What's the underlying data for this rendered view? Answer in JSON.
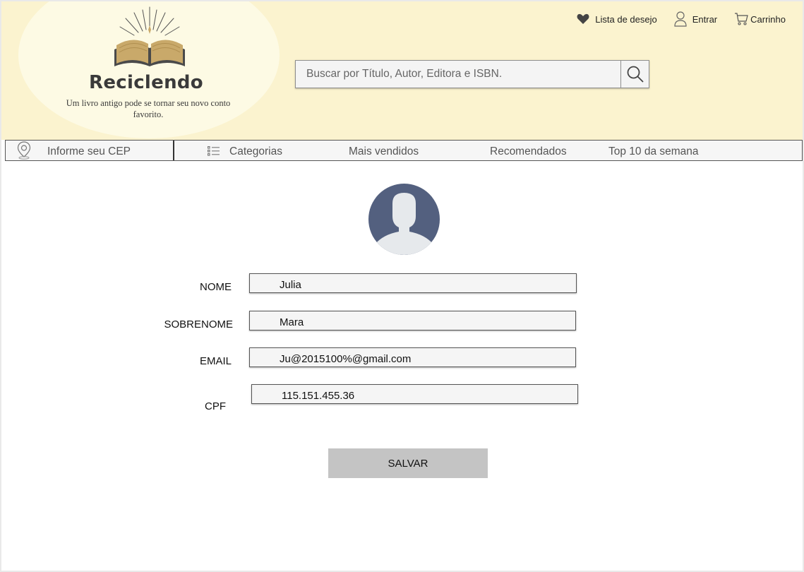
{
  "brand": {
    "name": "Reciclendo",
    "tagline": "Um livro antigo pode se tornar seu novo conto favorito."
  },
  "top_links": {
    "wishlist": "Lista de desejo",
    "login": "Entrar",
    "cart": "Carrinho"
  },
  "search": {
    "placeholder": "Buscar por Título, Autor, Editora e ISBN."
  },
  "nav": {
    "cep": "Informe seu CEP",
    "categories": "Categorias",
    "best_sellers": "Mais vendidos",
    "recommended": "Recomendados",
    "top10": "Top 10 da semana"
  },
  "form": {
    "nome_label": "NOME",
    "nome_value": "Julia",
    "sobrenome_label": "SOBRENOME",
    "sobrenome_value": "Mara",
    "email_label": "EMAIL",
    "email_value": "Ju@2015100%@gmail.com",
    "cpf_label": "CPF",
    "cpf_value": "115.151.455.36",
    "save_label": "SALVAR"
  },
  "colors": {
    "header_bg": "#fbf3cf",
    "logo_bg": "#fdfae4",
    "book": "#c9a96a",
    "avatar_bg": "#53607f",
    "avatar_figure": "#e6e9ec",
    "button_bg": "#c4c4c4"
  },
  "icons": {
    "wishlist": "heart-icon",
    "login": "user-icon",
    "cart": "cart-icon",
    "search": "search-icon",
    "cep": "location-pin-icon",
    "categories": "list-icon"
  }
}
